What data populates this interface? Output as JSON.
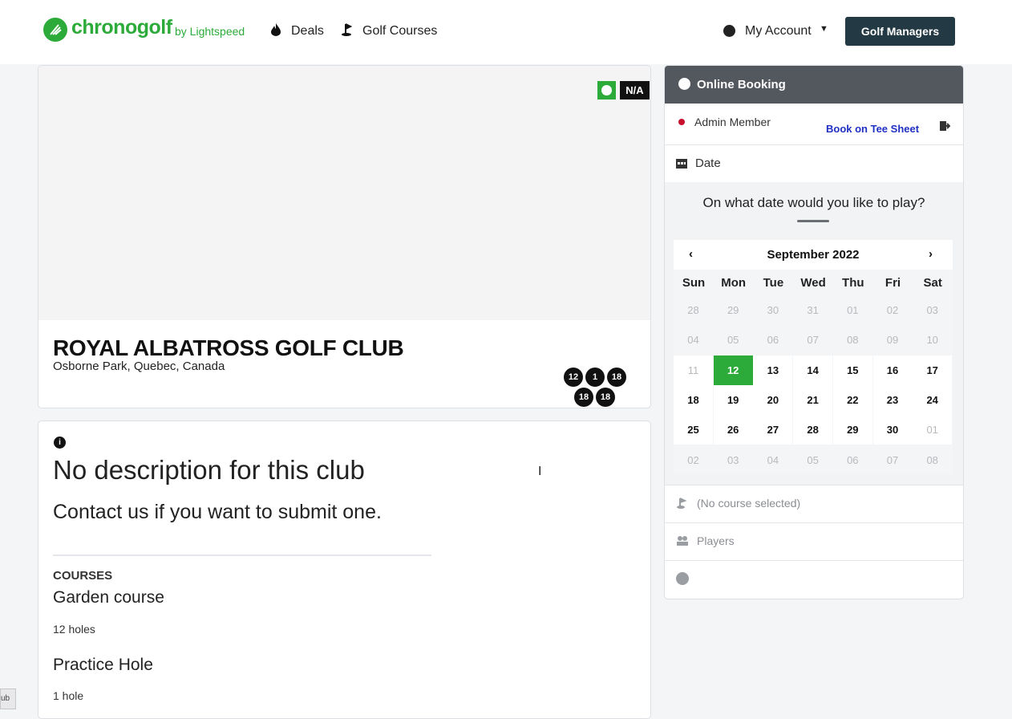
{
  "header": {
    "logo_text": "chronogolf",
    "logo_by": "by Lightspeed",
    "nav": {
      "deals": "Deals",
      "golf_courses": "Golf Courses"
    },
    "my_account": "My Account",
    "golf_managers": "Golf Managers"
  },
  "hero": {
    "na_badge": "N/A",
    "club_name": "ROYAL ALBATROSS GOLF CLUB",
    "location": "Osborne Park, Quebec, Canada",
    "hole_badges": [
      "12",
      "1",
      "18",
      "18",
      "18"
    ]
  },
  "description": {
    "title": "No description for this club",
    "subtitle": "Contact us if you want to submit one.",
    "courses_heading": "COURSES",
    "courses": [
      {
        "name": "Garden course",
        "holes": "12 holes"
      },
      {
        "name": "Practice Hole",
        "holes": "1 hole"
      }
    ]
  },
  "booking": {
    "title": "Online Booking",
    "member_type": "Admin  Member",
    "tee_sheet_link": "Book on Tee Sheet",
    "date_label": "Date",
    "date_question": "On what date would you like to play?",
    "calendar": {
      "month": "September 2022",
      "weekdays": [
        "Sun",
        "Mon",
        "Tue",
        "Wed",
        "Thu",
        "Fri",
        "Sat"
      ],
      "weeks": [
        [
          "28",
          "29",
          "30",
          "31",
          "01",
          "02",
          "03"
        ],
        [
          "04",
          "05",
          "06",
          "07",
          "08",
          "09",
          "10"
        ],
        [
          "11",
          "12",
          "13",
          "14",
          "15",
          "16",
          "17"
        ],
        [
          "18",
          "19",
          "20",
          "21",
          "22",
          "23",
          "24"
        ],
        [
          "25",
          "26",
          "27",
          "28",
          "29",
          "30",
          "01"
        ],
        [
          "02",
          "03",
          "04",
          "05",
          "06",
          "07",
          "08"
        ]
      ],
      "selected_day": "12"
    },
    "course_label": "(No course selected)",
    "players_label": "Players"
  },
  "colors": {
    "brand_green": "#2dab3a",
    "dark_button": "#233a44",
    "panel_header": "#53575e",
    "link_blue": "#2130c4"
  },
  "corner_tag": "ub"
}
